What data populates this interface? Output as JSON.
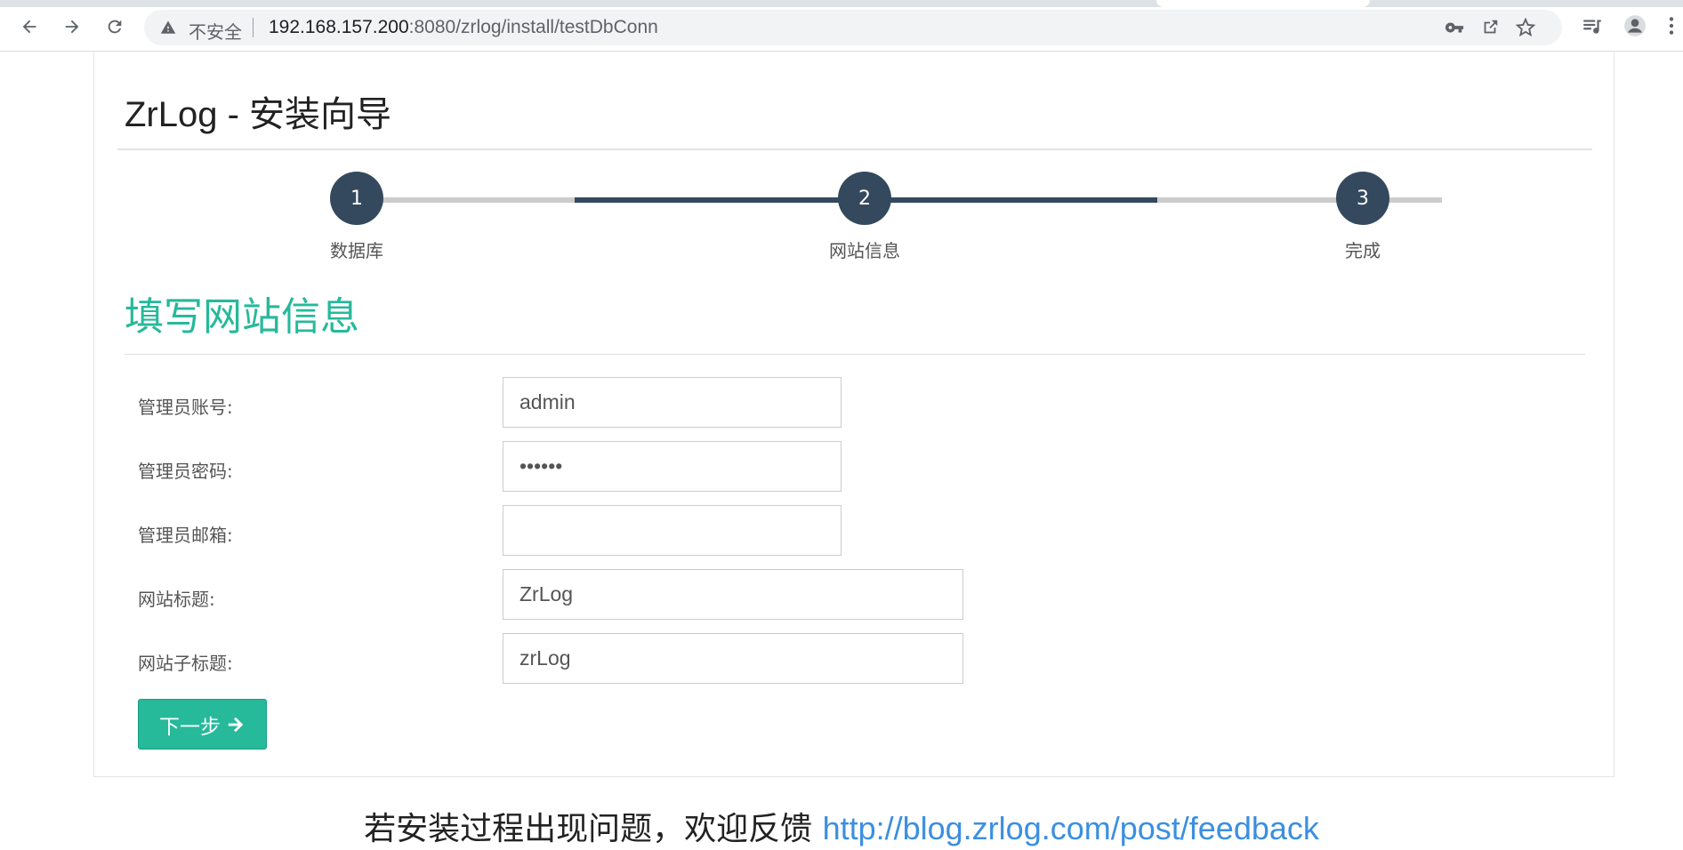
{
  "browser": {
    "security_label": "不安全",
    "url_host": "192.168.157.200",
    "url_rest": ":8080/zrlog/install/testDbConn"
  },
  "page": {
    "title": "ZrLog - 安装向导",
    "steps": [
      {
        "number": "1",
        "label": "数据库"
      },
      {
        "number": "2",
        "label": "网站信息"
      },
      {
        "number": "3",
        "label": "完成"
      }
    ],
    "section_title": "填写网站信息",
    "form": {
      "admin_account_label": "管理员账号:",
      "admin_account_value": "admin",
      "admin_password_label": "管理员密码:",
      "admin_password_value": "123456",
      "admin_email_label": "管理员邮箱:",
      "admin_email_value": "",
      "site_title_label": "网站标题:",
      "site_title_value": "ZrLog",
      "site_subtitle_label": "网站子标题:",
      "site_subtitle_value": "zrLog"
    },
    "next_button_label": "下一步",
    "footer_text": "若安装过程出现问题，欢迎反馈",
    "footer_link": "http://blog.zrlog.com/post/feedback"
  },
  "colors": {
    "accent": "#26b99a",
    "step_dark": "#34495e",
    "link": "#3b8fe0"
  }
}
